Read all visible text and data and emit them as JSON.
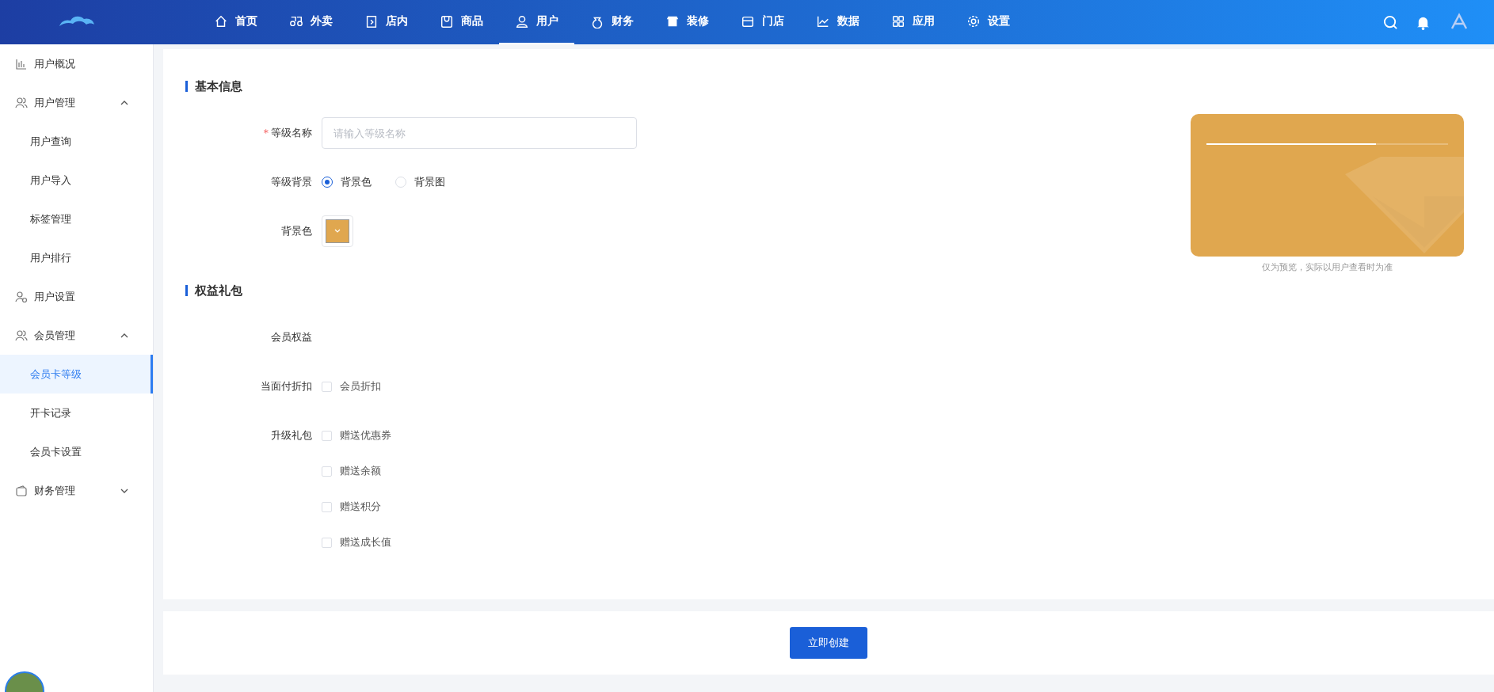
{
  "header": {
    "nav": [
      {
        "label": "首页",
        "selected": false
      },
      {
        "label": "外卖",
        "selected": false
      },
      {
        "label": "店内",
        "selected": false
      },
      {
        "label": "商品",
        "selected": false
      },
      {
        "label": "用户",
        "selected": true
      },
      {
        "label": "财务",
        "selected": false
      },
      {
        "label": "装修",
        "selected": false
      },
      {
        "label": "门店",
        "selected": false
      },
      {
        "label": "数据",
        "selected": false
      },
      {
        "label": "应用",
        "selected": false
      },
      {
        "label": "设置",
        "selected": false
      }
    ]
  },
  "sidebar": {
    "items": [
      {
        "label": "用户概况",
        "kind": "link",
        "selected": false
      },
      {
        "label": "用户管理",
        "kind": "group",
        "expanded": true,
        "children": [
          {
            "label": "用户查询",
            "selected": false
          },
          {
            "label": "用户导入",
            "selected": false
          },
          {
            "label": "标签管理",
            "selected": false
          },
          {
            "label": "用户排行",
            "selected": false
          }
        ]
      },
      {
        "label": "用户设置",
        "kind": "link",
        "selected": false
      },
      {
        "label": "会员管理",
        "kind": "group",
        "expanded": true,
        "children": [
          {
            "label": "会员卡等级",
            "selected": true
          },
          {
            "label": "开卡记录",
            "selected": false
          },
          {
            "label": "会员卡设置",
            "selected": false
          }
        ]
      },
      {
        "label": "财务管理",
        "kind": "group",
        "expanded": false
      }
    ]
  },
  "form": {
    "sections": [
      {
        "title": "基本信息",
        "rows": [
          {
            "kind": "input",
            "label": "等级名称",
            "required_mark": "*",
            "placeholder": "请输入等级名称"
          },
          {
            "kind": "radio",
            "label": "等级背景",
            "options": [
              {
                "label": "背景色",
                "selected": true
              },
              {
                "label": "背景图",
                "selected": false
              }
            ]
          },
          {
            "kind": "color",
            "label": "背景色",
            "color": "#e0a74f"
          }
        ]
      },
      {
        "title": "权益礼包",
        "rows": [
          {
            "kind": "text",
            "label": "会员权益"
          },
          {
            "kind": "checkbox",
            "label": "当面付折扣",
            "options": [
              {
                "label": "会员折扣",
                "checked": false
              }
            ]
          },
          {
            "kind": "checkbox",
            "label": "升级礼包",
            "options": [
              {
                "label": "赠送优惠券",
                "checked": false
              },
              {
                "label": "赠送余额",
                "checked": false
              },
              {
                "label": "赠送积分",
                "checked": false
              },
              {
                "label": "赠送成长值",
                "checked": false
              }
            ]
          }
        ]
      }
    ]
  },
  "preview": {
    "progress": {
      "level": 0.7
    },
    "note": "仅为预览，实际以用户查看时为准"
  },
  "footer": {
    "button": "立即创建"
  }
}
